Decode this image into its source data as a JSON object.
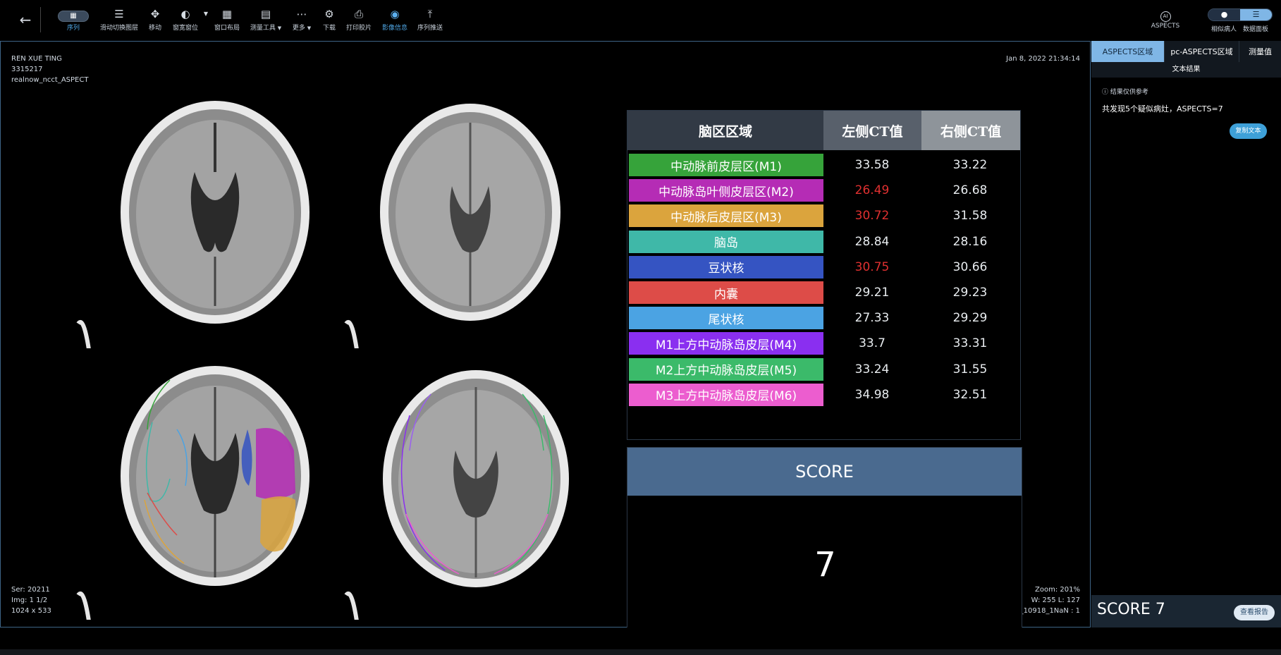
{
  "toolbar": {
    "back_icon": "arrow-left-icon",
    "tools": [
      {
        "label": "序列",
        "icon": "grid-icon"
      },
      {
        "label": "滑动切换图层",
        "icon": "layers-icon"
      },
      {
        "label": "移动",
        "icon": "move-icon"
      },
      {
        "label": "窗宽窗位",
        "icon": "contrast-icon"
      },
      {
        "label": "窗口布局",
        "icon": "layout-grid-icon"
      },
      {
        "label": "测量工具",
        "icon": "ruler-icon"
      },
      {
        "label": "更多",
        "icon": "more-icon"
      },
      {
        "label": "下载",
        "icon": "download-icon"
      },
      {
        "label": "打印胶片",
        "icon": "print-icon"
      },
      {
        "label": "影像信息",
        "icon": "eye-icon"
      },
      {
        "label": "序列推送",
        "icon": "upload-icon"
      }
    ],
    "ai_label": "ASPECTS",
    "ai_icon": "ai-icon",
    "similar_label": "相似病人",
    "dashboard_label": "数据面板"
  },
  "viewer": {
    "patient_name": "REN XUE TING",
    "patient_id": "3315217",
    "series_desc": "realnow_ncct_ASPECT",
    "datetime": "Jan 8, 2022 21:34:14",
    "ser": "Ser: 20211",
    "img": "Img: 1 1/2",
    "dims": "1024 x 533",
    "zoom": "Zoom: 201%",
    "wl": "W: 255 L: 127",
    "iso": "ISO_10918_1NaN : 1"
  },
  "table": {
    "headers": [
      "脑区区域",
      "左侧CT值",
      "右侧CT值"
    ],
    "header_colors": [
      "#323a45",
      "#58606b",
      "#8e949a"
    ],
    "rows": [
      {
        "name": "中动脉前皮层区(M1)",
        "left": "33.58",
        "right": "33.22",
        "color": "#36a33a",
        "left_red": false
      },
      {
        "name": "中动脉岛叶侧皮层区(M2)",
        "left": "26.49",
        "right": "26.68",
        "color": "#b52cb5",
        "left_red": true
      },
      {
        "name": "中动脉后皮层区(M3)",
        "left": "30.72",
        "right": "31.58",
        "color": "#dba43d",
        "left_red": true
      },
      {
        "name": "脑岛",
        "left": "28.84",
        "right": "28.16",
        "color": "#3fb8a8",
        "left_red": false
      },
      {
        "name": "豆状核",
        "left": "30.75",
        "right": "30.66",
        "color": "#3554c2",
        "left_red": true
      },
      {
        "name": "内囊",
        "left": "29.21",
        "right": "29.23",
        "color": "#dd4c48",
        "left_red": false
      },
      {
        "name": "尾状核",
        "left": "27.33",
        "right": "29.29",
        "color": "#4ba3e3",
        "left_red": false
      },
      {
        "name": "M1上方中动脉岛皮层(M4)",
        "left": "33.7",
        "right": "33.31",
        "color": "#8a2ff0",
        "left_red": false
      },
      {
        "name": "M2上方中动脉岛皮层(M5)",
        "left": "33.24",
        "right": "31.55",
        "color": "#3bba6a",
        "left_red": false
      },
      {
        "name": "M3上方中动脉岛皮层(M6)",
        "left": "34.98",
        "right": "32.51",
        "color": "#ec5dcf",
        "left_red": false
      }
    ]
  },
  "score_panel": {
    "title": "SCORE",
    "value": "7"
  },
  "right_panel": {
    "tabs": [
      "ASPECTS区域",
      "pc-ASPECTS区域",
      "测量值"
    ],
    "subtab": "文本结果",
    "note": "结果仅供参考",
    "result_text": "共发现5个疑似病灶，ASPECTS=7",
    "copy_button": "复制文本",
    "score_text": "SCORE 7",
    "report_button": "查看报告"
  }
}
